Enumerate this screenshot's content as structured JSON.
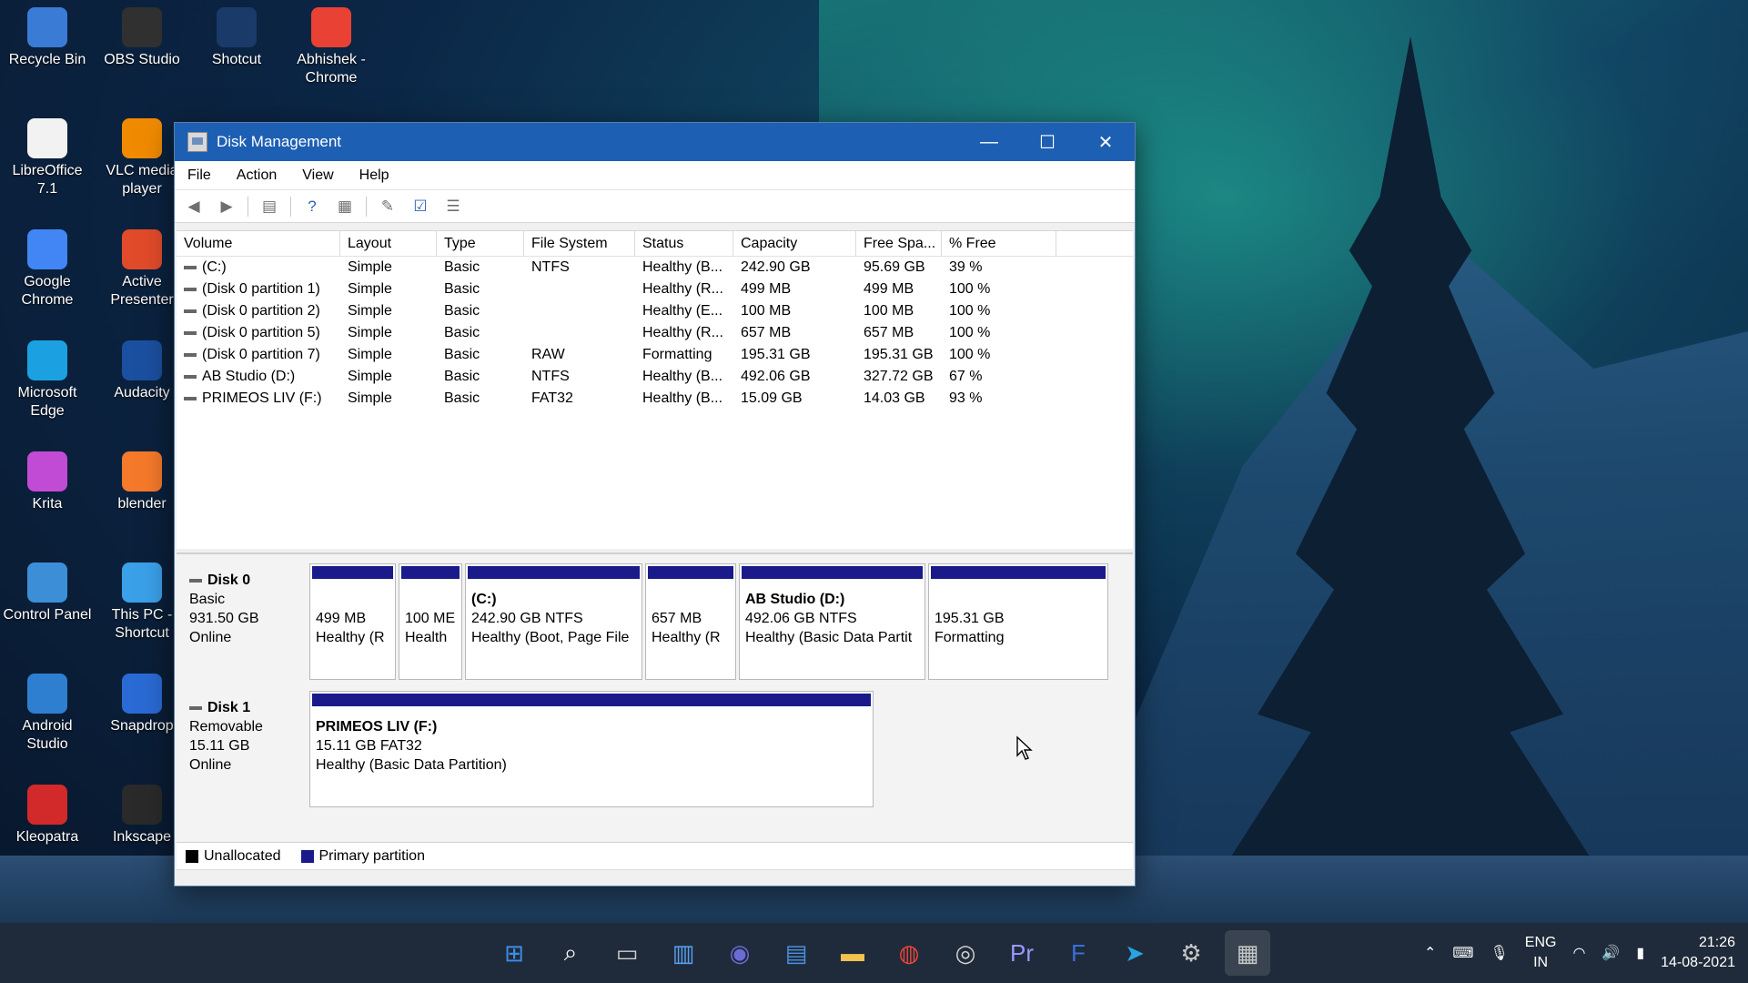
{
  "desktop": {
    "icons": [
      {
        "label": "Recycle Bin",
        "icon": "recycle-bin-icon",
        "color": "#3a7bd5"
      },
      {
        "label": "OBS Studio",
        "icon": "obs-icon",
        "color": "#303030"
      },
      {
        "label": "Shotcut",
        "icon": "shotcut-icon",
        "color": "#1a3a6a"
      },
      {
        "label": "Abhishek - Chrome",
        "icon": "chrome-icon",
        "color": "#e94235"
      },
      {
        "label": "LibreOffice 7.1",
        "icon": "libreoffice-icon",
        "color": "#f2f2f2"
      },
      {
        "label": "VLC media player",
        "icon": "vlc-icon",
        "color": "#f08a00"
      },
      {
        "label": "Google Chrome",
        "icon": "chrome-icon",
        "color": "#4285f4"
      },
      {
        "label": "Active Presenter",
        "icon": "activepresenter-icon",
        "color": "#e24b2a"
      },
      {
        "label": "Microsoft Edge",
        "icon": "edge-icon",
        "color": "#1ba1e2"
      },
      {
        "label": "Audacity",
        "icon": "audacity-icon",
        "color": "#1b4fa0"
      },
      {
        "label": "Krita",
        "icon": "krita-icon",
        "color": "#c24bd6"
      },
      {
        "label": "blender",
        "icon": "blender-icon",
        "color": "#f5792a"
      },
      {
        "label": "Control Panel",
        "icon": "control-panel-icon",
        "color": "#3c8fd6"
      },
      {
        "label": "This PC - Shortcut",
        "icon": "this-pc-icon",
        "color": "#3aa0e8"
      },
      {
        "label": "Android Studio",
        "icon": "android-studio-icon",
        "color": "#2f7fd0"
      },
      {
        "label": "Snapdrop",
        "icon": "snapdrop-icon",
        "color": "#2a6ad4"
      },
      {
        "label": "Kleopatra",
        "icon": "kleopatra-icon",
        "color": "#d22a2a"
      },
      {
        "label": "Inkscape",
        "icon": "inkscape-icon",
        "color": "#2a2a2a"
      }
    ]
  },
  "window": {
    "title": "Disk Management",
    "minimize": "—",
    "maximize": "☐",
    "close": "✕"
  },
  "menu": [
    "File",
    "Action",
    "View",
    "Help"
  ],
  "volume_table": {
    "headers": [
      "Volume",
      "Layout",
      "Type",
      "File System",
      "Status",
      "Capacity",
      "Free Spa...",
      "% Free"
    ],
    "rows": [
      {
        "volume": "(C:)",
        "layout": "Simple",
        "type": "Basic",
        "fs": "NTFS",
        "status": "Healthy (B...",
        "capacity": "242.90 GB",
        "free": "95.69 GB",
        "pct": "39 %"
      },
      {
        "volume": "(Disk 0 partition 1)",
        "layout": "Simple",
        "type": "Basic",
        "fs": "",
        "status": "Healthy (R...",
        "capacity": "499 MB",
        "free": "499 MB",
        "pct": "100 %"
      },
      {
        "volume": "(Disk 0 partition 2)",
        "layout": "Simple",
        "type": "Basic",
        "fs": "",
        "status": "Healthy (E...",
        "capacity": "100 MB",
        "free": "100 MB",
        "pct": "100 %"
      },
      {
        "volume": "(Disk 0 partition 5)",
        "layout": "Simple",
        "type": "Basic",
        "fs": "",
        "status": "Healthy (R...",
        "capacity": "657 MB",
        "free": "657 MB",
        "pct": "100 %"
      },
      {
        "volume": "(Disk 0 partition 7)",
        "layout": "Simple",
        "type": "Basic",
        "fs": "RAW",
        "status": "Formatting",
        "capacity": "195.31 GB",
        "free": "195.31 GB",
        "pct": "100 %"
      },
      {
        "volume": "AB Studio (D:)",
        "layout": "Simple",
        "type": "Basic",
        "fs": "NTFS",
        "status": "Healthy (B...",
        "capacity": "492.06 GB",
        "free": "327.72 GB",
        "pct": "67 %"
      },
      {
        "volume": "PRIMEOS LIV (F:)",
        "layout": "Simple",
        "type": "Basic",
        "fs": "FAT32",
        "status": "Healthy (B...",
        "capacity": "15.09 GB",
        "free": "14.03 GB",
        "pct": "93 %"
      }
    ]
  },
  "disks": [
    {
      "name": "Disk 0",
      "kind": "Basic",
      "size": "931.50 GB",
      "state": "Online",
      "partitions": [
        {
          "name": "",
          "size": "499 MB",
          "status": "Healthy (R"
        },
        {
          "name": "",
          "size": "100 ME",
          "status": "Health"
        },
        {
          "name": "(C:)",
          "size": "242.90 GB NTFS",
          "status": "Healthy (Boot, Page File"
        },
        {
          "name": "",
          "size": "657 MB",
          "status": "Healthy (R"
        },
        {
          "name": "AB Studio  (D:)",
          "size": "492.06 GB NTFS",
          "status": "Healthy (Basic Data Partit"
        },
        {
          "name": "",
          "size": "195.31 GB",
          "status": "Formatting"
        }
      ]
    },
    {
      "name": "Disk 1",
      "kind": "Removable",
      "size": "15.11 GB",
      "state": "Online",
      "partitions": [
        {
          "name": "PRIMEOS LIV  (F:)",
          "size": "15.11 GB FAT32",
          "status": "Healthy (Basic Data Partition)"
        }
      ]
    }
  ],
  "legend": [
    {
      "label": "Unallocated",
      "color": "#000000"
    },
    {
      "label": "Primary partition",
      "color": "#1a1a8a"
    }
  ],
  "taskbar": {
    "apps": [
      "windows-start-icon",
      "search-icon",
      "task-view-icon",
      "widgets-icon",
      "chat-icon",
      "notepad-icon",
      "file-explorer-icon",
      "chrome-icon",
      "obs-icon",
      "premiere-icon",
      "foxit-icon",
      "telegram-icon",
      "settings-icon",
      "disk-management-icon"
    ],
    "app_glyphs": [
      "⊞",
      "⌕",
      "▭",
      "▥",
      "◉",
      "▤",
      "▬",
      "◍",
      "◎",
      "Pr",
      "F",
      "➤",
      "⚙",
      "▦"
    ],
    "lang_top": "ENG",
    "lang_bottom": "IN",
    "time": "21:26",
    "date": "14-08-2021"
  }
}
